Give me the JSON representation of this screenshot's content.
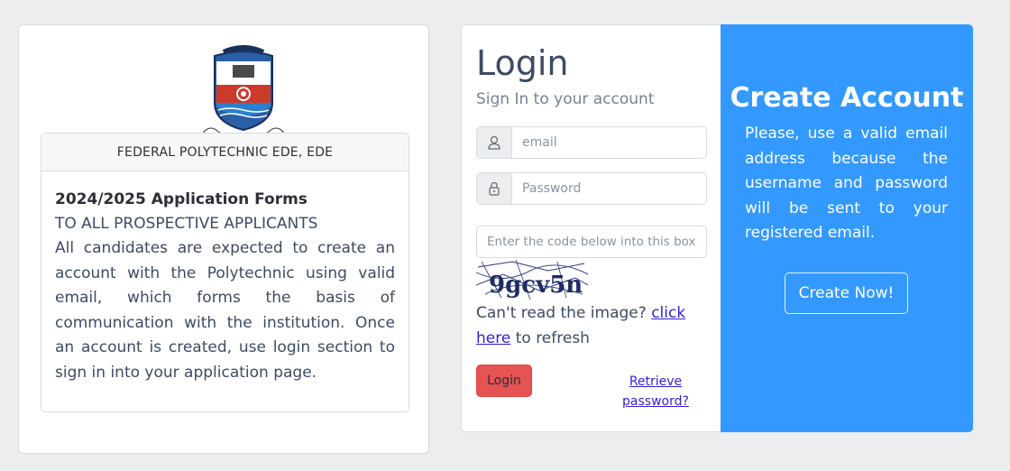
{
  "info": {
    "institution": "FEDERAL POLYTECHNIC EDE, EDE",
    "title": "2024/2025 Application Forms",
    "subtitle": "TO ALL PROSPECTIVE APPLICANTS",
    "body": "All candidates are expected to create an account with the Polytechnic using valid email, which forms the basis of communication with the institution. Once an account is created, use login section to sign in into your application page.",
    "logo_motto": "KNOWLEDGE, SKILL AND CHARACTER",
    "logo_top_text": "THE FEDERAL POLYTECHNIC",
    "logo_bottom_text": "EDE"
  },
  "login": {
    "title": "Login",
    "subtitle": "Sign In to your account",
    "email_placeholder": "email",
    "password_placeholder": "Password",
    "code_placeholder": "Enter the code below into this box",
    "captcha_text": "9gcv5n",
    "cant_read": "Can't read the image?",
    "click_here": "click here",
    "to_refresh": "to refresh",
    "login_button": "Login",
    "retrieve_password": "Retrieve password?"
  },
  "create": {
    "title": "Create Account",
    "text": "Please, use a valid email address because the username and password will be sent to your registered email.",
    "button": "Create Now!"
  },
  "colors": {
    "primary_blue": "#3399ff",
    "danger_red": "#e55353",
    "link": "#321fdb"
  },
  "icons": {
    "email": "user-icon",
    "password": "lock-icon"
  }
}
